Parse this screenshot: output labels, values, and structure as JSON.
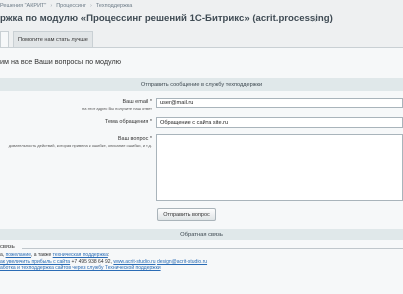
{
  "breadcrumb": [
    "Решения \"АКРИТ\"",
    "Процессинг",
    "Техподдержка"
  ],
  "page_title": "ржка по модулю «Процессинг решений 1С-Битрикс» (acrit.processing)",
  "tabs": [
    "",
    "Помогите нам стать лучше"
  ],
  "intro": "им на все Ваши вопросы по модулю",
  "form": {
    "header": "Отправить сообщение в службу техподдержки",
    "email_label": "Ваш email",
    "email_hint": "на этот адрес Вы получите наш ответ",
    "email_value": "user@mail.ru",
    "subject_label": "Тема обращения",
    "subject_value": "Обращение с сайта site.ru",
    "question_label": "Ваш вопрос",
    "question_hint": "довательность действий, которая привела к ошибке, описание ошибки, и т.д.",
    "question_value": "",
    "required_mark": "*",
    "submit_label": "Отправить вопрос"
  },
  "feedback": {
    "header": "Обратная связь",
    "subheader": "связь",
    "line1_pre": "а, ",
    "line1_link1": "пожелание",
    "line1_mid": ", а также ",
    "line1_link2": "техническая поддержка",
    "line1_end": ":",
    "line2_link": "ак увеличить прибыль с сайта",
    "line2_phone": " +7 495 938 64 92, ",
    "line2_link2": "www.acrit-studio.ru",
    "line2_link3": "design@acrit-studio.ru",
    "line3_link": "аботка и техподдержка сайтов через службу Технической поддержки"
  }
}
